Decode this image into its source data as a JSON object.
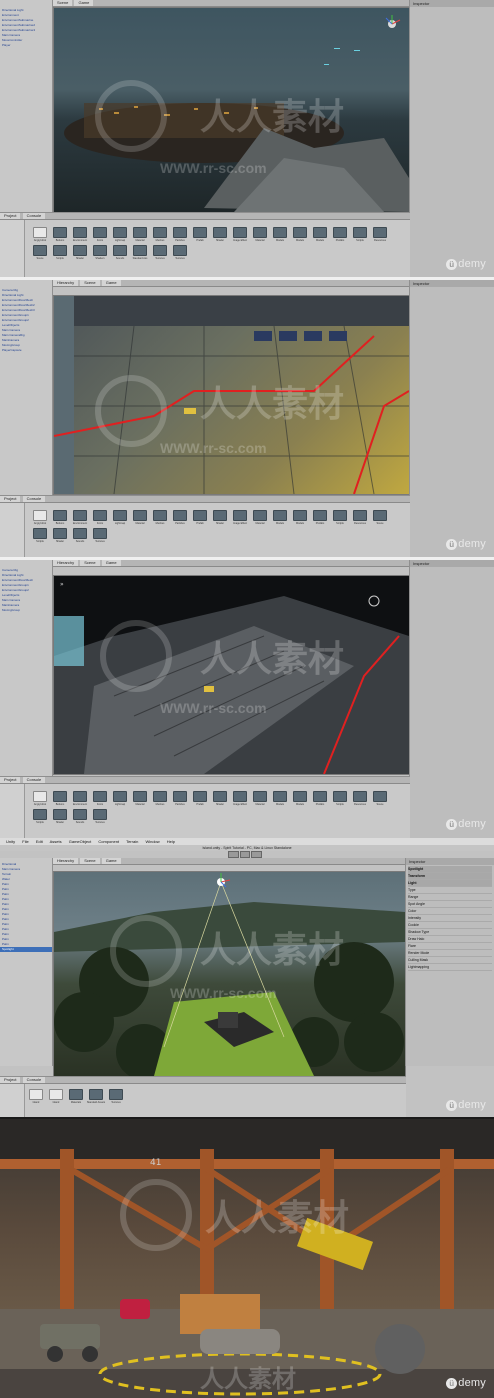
{
  "watermark": {
    "cn": "人人素材",
    "url": "WWW.rr-sc.com"
  },
  "udemy_label": "demy",
  "frames": [
    {
      "hierarchy": [
        "Directional Light",
        "Environment",
        "EnvironmentSubmarine",
        "EnvironmentSubmarine2",
        "EnvironmentSubmarine3",
        "Main Camera",
        "MoveController",
        "Player"
      ],
      "tabs": [
        "Scene",
        "Game"
      ],
      "inspector_title": "Inspector",
      "project_tabs": [
        "Project",
        "Console"
      ],
      "assets": [
        "Angryrobot",
        "Buttons",
        "Environment",
        "Fonts",
        "Lightmap",
        "Material",
        "Meshes",
        "Particles",
        "Prefab",
        "Shader",
        "Image Effect",
        "Material",
        "Models",
        "Models",
        "Models",
        "Prefabs",
        "Scripts",
        "Resources",
        "Scene",
        "Scripts",
        "Shader",
        "Shaders",
        "Sounds",
        "Standard Ass",
        "Textures",
        "Textures"
      ]
    },
    {
      "hierarchy": [
        "Camera Rig",
        "Directional Light",
        "EnvironmentFloorMesh",
        "EnvironmentFloorMesh2",
        "EnvironmentFloorMesh3",
        "EnvironmentGroup1",
        "EnvironmentGroup2",
        "LevelObjects",
        "Main Camera",
        "Main CameraRig",
        "MainCamera",
        "MovingGroup",
        "PlayerCapsule"
      ],
      "tabs": [
        "Hierarchy",
        "Scene",
        "Game"
      ],
      "inspector_title": "Inspector",
      "project_tabs": [
        "Project",
        "Console"
      ],
      "assets": [
        "Angryrobot",
        "Buttons",
        "Environment",
        "Fonts",
        "Lightmap",
        "Material",
        "Meshes",
        "Particles",
        "Prefab",
        "Shader",
        "Image Effect",
        "Material",
        "Models",
        "Models",
        "Prefabs",
        "Scripts",
        "Resources",
        "Scene",
        "Scripts",
        "Shader",
        "Sounds",
        "Textures"
      ]
    },
    {
      "hierarchy": [
        "Camera Rig",
        "Directional Light",
        "EnvironmentFloorMesh",
        "EnvironmentGroup1",
        "EnvironmentGroup2",
        "LevelObjects",
        "Main Camera",
        "MainCamera",
        "MovingGroup"
      ],
      "tabs": [
        "Hierarchy",
        "Scene",
        "Game"
      ],
      "inspector_title": "Inspector",
      "project_tabs": [
        "Project",
        "Console"
      ],
      "assets": [
        "Angryrobot",
        "Buttons",
        "Environment",
        "Fonts",
        "Lightmap",
        "Material",
        "Meshes",
        "Particles",
        "Prefab",
        "Shader",
        "Image Effect",
        "Material",
        "Models",
        "Models",
        "Prefabs",
        "Scripts",
        "Resources",
        "Scene",
        "Scripts",
        "Shader",
        "Sounds",
        "Textures"
      ]
    },
    {
      "menubar": [
        "Unity",
        "File",
        "Edit",
        "Assets",
        "GameObject",
        "Component",
        "Terrain",
        "Window",
        "Help"
      ],
      "window_title": "Island.unity - Spirit Tutorial - PC, Mac & Linux Standalone",
      "hierarchy": [
        "Directional",
        "Main Camera",
        "Terrain",
        "Water",
        "Palm",
        "Palm",
        "Palm",
        "Palm",
        "Palm",
        "Palm",
        "Palm",
        "Palm",
        "Palm",
        "Palm",
        "Palm",
        "Palm",
        "Palm",
        "Spotlight"
      ],
      "tabs": [
        "Hierarchy",
        "Scene",
        "Game"
      ],
      "inspector_title": "Inspector",
      "inspector_items": [
        "Spotlight",
        "Transform",
        "Light",
        "Type",
        "Range",
        "Spot Angle",
        "Color",
        "Intensity",
        "Cookie",
        "Shadow Type",
        "Draw Halo",
        "Flare",
        "Render Mode",
        "Culling Mask",
        "Lightmapping"
      ],
      "project_tabs": [
        "Project",
        "Console"
      ],
      "assets": [
        "Island",
        "Island",
        "Materials",
        "Standard Assets",
        "Textures"
      ]
    }
  ]
}
